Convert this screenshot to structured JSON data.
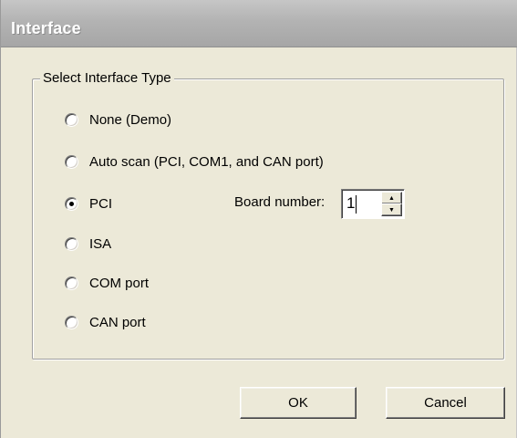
{
  "window": {
    "title": "Interface"
  },
  "group": {
    "title": "Select Interface Type",
    "options": [
      {
        "label": "None (Demo)",
        "selected": false
      },
      {
        "label": "Auto scan (PCI, COM1, and CAN port)",
        "selected": false
      },
      {
        "label": "PCI",
        "selected": true
      },
      {
        "label": "ISA",
        "selected": false
      },
      {
        "label": "COM port",
        "selected": false
      },
      {
        "label": "CAN port",
        "selected": false
      }
    ],
    "board_number": {
      "label": "Board number:",
      "value": "1"
    }
  },
  "buttons": {
    "ok": "OK",
    "cancel": "Cancel"
  },
  "icons": {
    "spin_up": "arrow-up-icon",
    "spin_down": "arrow-down-icon"
  },
  "colors": {
    "dialog_background": "#ece9d8",
    "titlebar": "#b3b3b3",
    "title_text": "#ffffff"
  }
}
